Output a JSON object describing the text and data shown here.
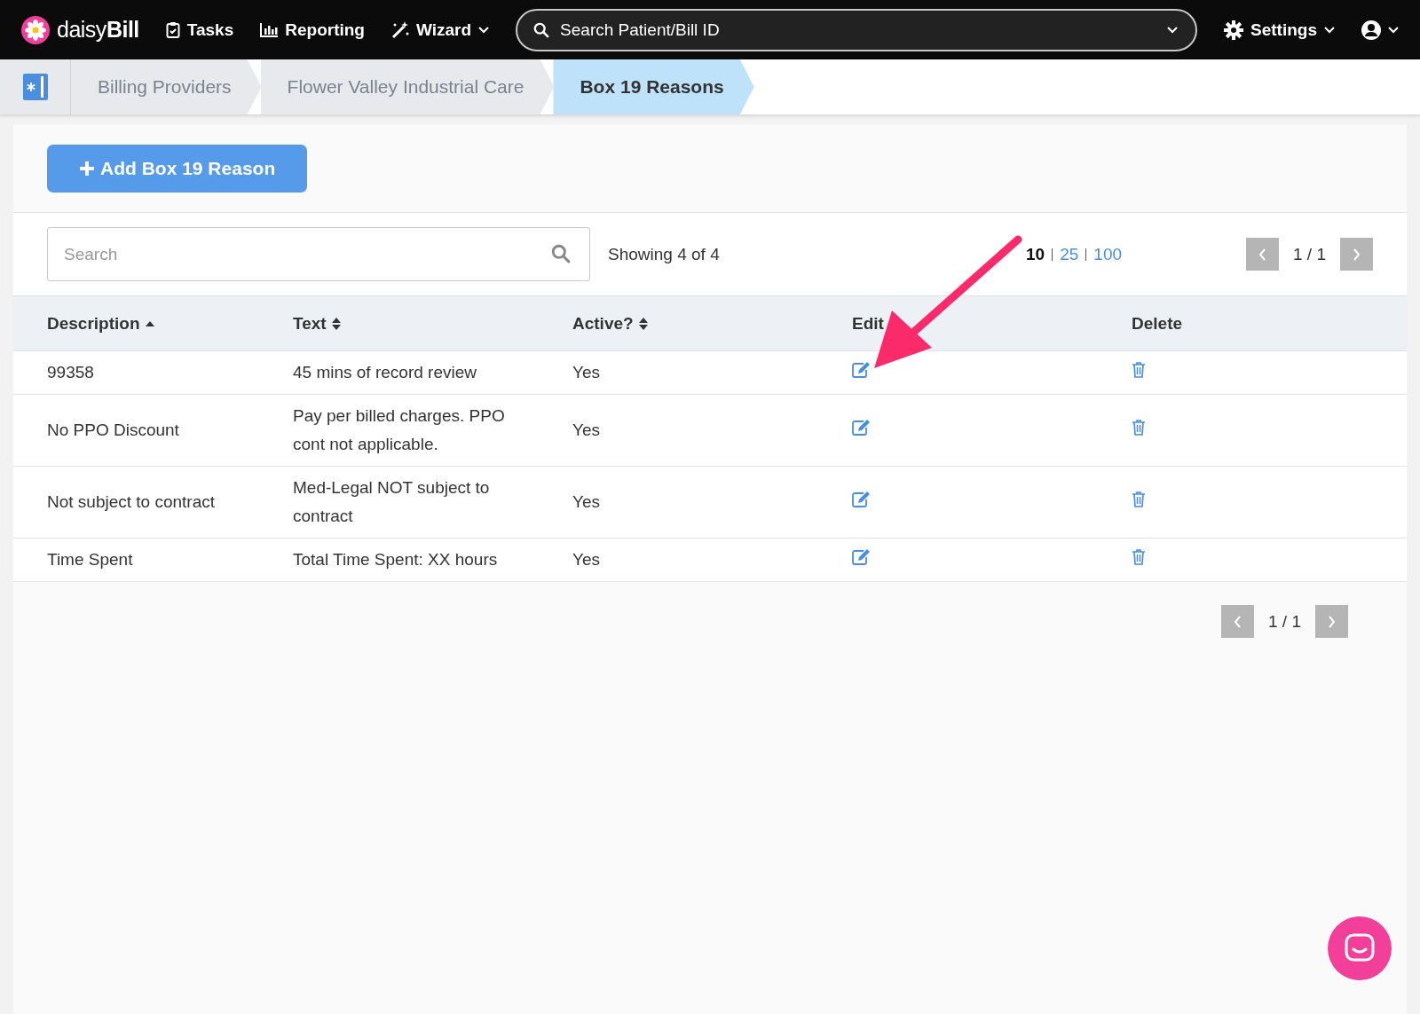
{
  "nav": {
    "brand_light": "daisy",
    "brand_bold": "Bill",
    "items": [
      {
        "kind": "tasks",
        "label": "Tasks",
        "caret": false
      },
      {
        "kind": "reporting",
        "label": "Reporting",
        "caret": false
      },
      {
        "kind": "wizard",
        "label": "Wizard",
        "caret": true
      }
    ],
    "search": {
      "placeholder": "Search Patient/Bill ID"
    },
    "settings": {
      "label": "Settings"
    }
  },
  "breadcrumbs": [
    {
      "label": "Billing Providers",
      "selected": false
    },
    {
      "label": "Flower Valley Industrial Care",
      "selected": false
    },
    {
      "label": "Box 19 Reasons",
      "selected": true
    }
  ],
  "add_button": {
    "label": "Add Box 19 Reason"
  },
  "search": {
    "placeholder": "Search"
  },
  "showing": "Showing 4 of 4",
  "page_sizes": [
    {
      "label": "10",
      "selected": true
    },
    {
      "label": "25",
      "selected": false
    },
    {
      "label": "100",
      "selected": false
    }
  ],
  "pager": {
    "label": "1 / 1"
  },
  "table": {
    "columns": [
      {
        "label": "Description",
        "sortable": true,
        "sorted_asc": true
      },
      {
        "label": "Text",
        "sortable": true,
        "sorted_asc": false
      },
      {
        "label": "Active?",
        "sortable": true,
        "sorted_asc": false
      },
      {
        "label": "Edit",
        "sortable": false
      },
      {
        "label": "Delete",
        "sortable": false
      }
    ],
    "rows": [
      {
        "description": "99358",
        "text": "45 mins of record review",
        "active": "Yes"
      },
      {
        "description": "No PPO Discount",
        "text": "Pay per billed charges. PPO cont not applicable.",
        "active": "Yes"
      },
      {
        "description": "Not subject to contract",
        "text": "Med-Legal NOT subject to contract",
        "active": "Yes"
      },
      {
        "description": "Time Spent",
        "text": "Total Time Spent: XX hours",
        "active": "Yes"
      }
    ]
  },
  "bottom_pager": {
    "label": "1 / 1"
  }
}
